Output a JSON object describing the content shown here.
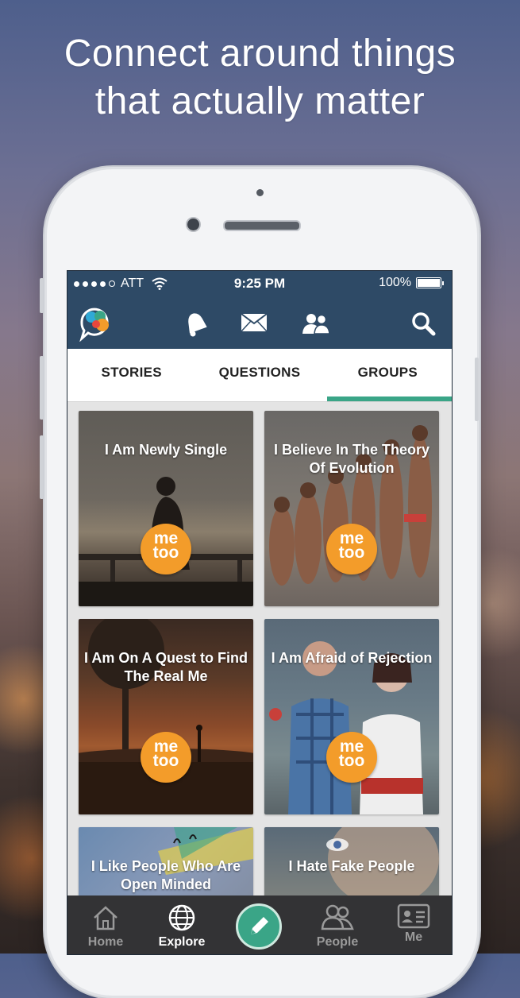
{
  "headline": {
    "line1": "Connect around things",
    "line2": "that actually matter"
  },
  "statusbar": {
    "carrier": "ATT",
    "time": "9:25 PM",
    "battery": "100%"
  },
  "toolbar": {
    "icons": [
      "app-logo-icon",
      "bell-icon",
      "mail-icon",
      "people-icon",
      "search-icon"
    ]
  },
  "tabs": [
    {
      "label": "STORIES",
      "active": false
    },
    {
      "label": "QUESTIONS",
      "active": false
    },
    {
      "label": "GROUPS",
      "active": true
    }
  ],
  "groups": [
    {
      "title": "I Am Newly Single",
      "button": "me too"
    },
    {
      "title": "I Believe In The Theory Of Evolution",
      "button": "me too"
    },
    {
      "title": "I Am On A Quest to Find The Real Me",
      "button": "me too"
    },
    {
      "title": "I Am Afraid of Rejection",
      "button": "me too"
    },
    {
      "title": "I Like People Who Are Open Minded",
      "button": ""
    },
    {
      "title": "I Hate Fake People",
      "button": ""
    }
  ],
  "metoo": {
    "line1": "me",
    "line2": "too"
  },
  "bottomnav": [
    {
      "label": "Home",
      "icon": "home-icon",
      "active": false
    },
    {
      "label": "Explore",
      "icon": "globe-icon",
      "active": true
    },
    {
      "label": "",
      "icon": "pencil-icon",
      "active": false
    },
    {
      "label": "People",
      "icon": "people-icon",
      "active": false
    },
    {
      "label": "Me",
      "icon": "id-card-icon",
      "active": false
    }
  ],
  "colors": {
    "bar": "#2e4a66",
    "accent": "#3aa587",
    "metoo": "#f39c2a"
  }
}
